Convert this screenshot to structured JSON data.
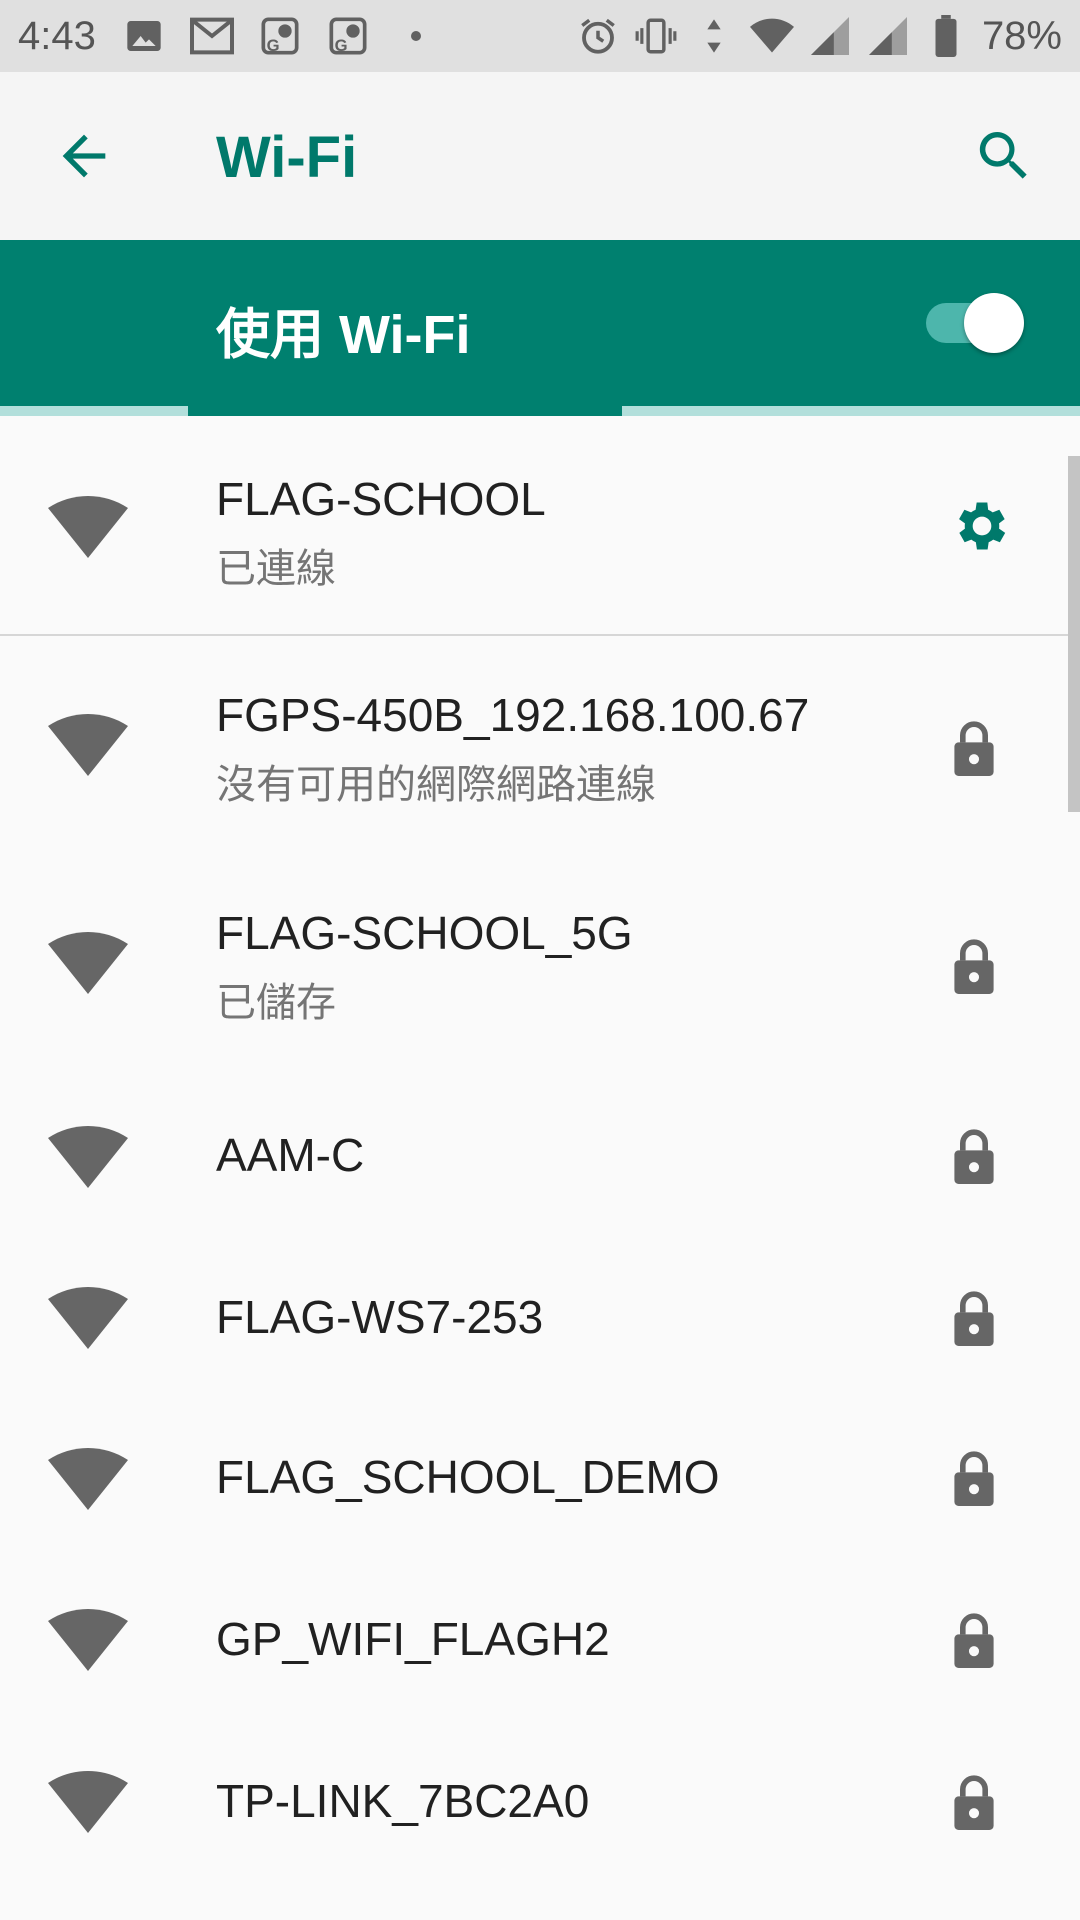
{
  "status_bar": {
    "time": "4:43",
    "left_icons": [
      "image-icon",
      "gmail-icon",
      "maps-notification-icon",
      "maps-notification-icon",
      "dot-icon"
    ],
    "right_icons": [
      "alarm-icon",
      "vibrate-icon",
      "data-arrows-icon",
      "wifi-signal-icon",
      "cell-signal-icon",
      "cell-signal-icon",
      "battery-icon"
    ],
    "battery_percent": "78%"
  },
  "app_bar": {
    "back_icon": "arrow-back-icon",
    "title": "Wi-Fi",
    "search_icon": "search-icon"
  },
  "master_switch": {
    "label": "使用 Wi-Fi",
    "enabled": true
  },
  "colors": {
    "accent": "#00796b",
    "switch_bar": "#00806f",
    "icon_grey": "#666666"
  },
  "networks": [
    {
      "ssid": "FLAG-SCHOOL",
      "status": "已連線",
      "secured": false,
      "connected": true,
      "action_icon": "gear-icon"
    },
    {
      "ssid": "FGPS-450B_192.168.100.67",
      "status": "沒有可用的網際網路連線",
      "secured": true,
      "action_icon": "lock-icon"
    },
    {
      "ssid": "FLAG-SCHOOL_5G",
      "status": "已儲存",
      "secured": true,
      "action_icon": "lock-icon"
    },
    {
      "ssid": "AAM-C",
      "status": "",
      "secured": true,
      "action_icon": "lock-icon"
    },
    {
      "ssid": "FLAG-WS7-253",
      "status": "",
      "secured": true,
      "action_icon": "lock-icon"
    },
    {
      "ssid": "FLAG_SCHOOL_DEMO",
      "status": "",
      "secured": true,
      "action_icon": "lock-icon"
    },
    {
      "ssid": "GP_WIFI_FLAGH2",
      "status": "",
      "secured": true,
      "action_icon": "lock-icon"
    },
    {
      "ssid": "TP-LINK_7BC2A0",
      "status": "",
      "secured": true,
      "action_icon": "lock-icon"
    }
  ]
}
